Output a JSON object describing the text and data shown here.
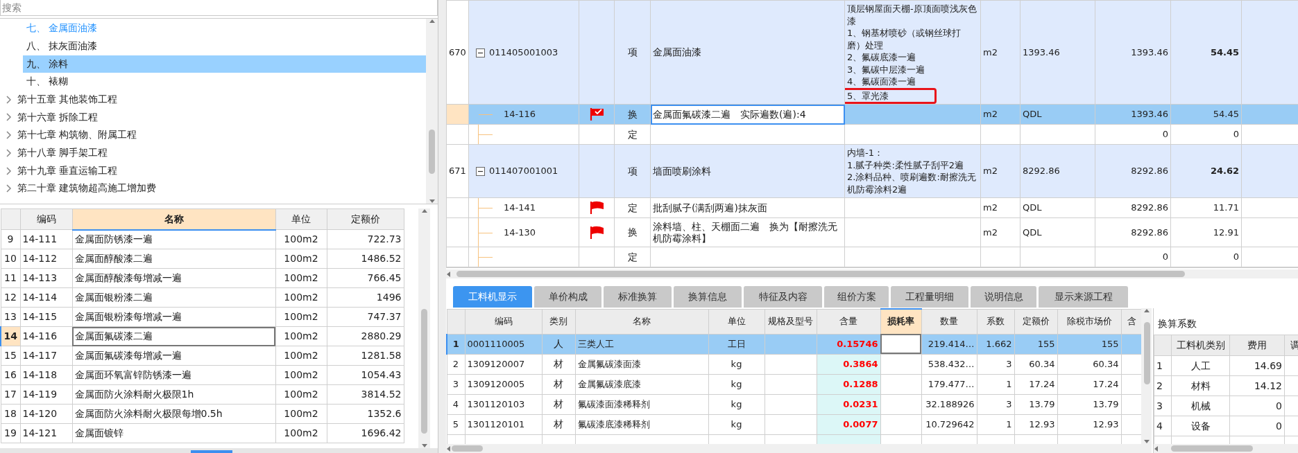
{
  "search": {
    "placeholder": "搜索"
  },
  "tree": {
    "items": [
      {
        "expanded": true,
        "children": [
          {
            "label": "七、 金属面油漆",
            "active": true,
            "selected": false
          },
          {
            "label": "八、 抹灰面油漆",
            "active": false,
            "selected": false
          },
          {
            "label": "九、 涂料",
            "active": false,
            "selected": true
          },
          {
            "label": "十、 裱糊",
            "active": false,
            "selected": false
          }
        ]
      },
      {
        "label": "第十五章 其他装饰工程",
        "expanded": false,
        "active": false,
        "selected": false
      },
      {
        "label": "第十六章 拆除工程",
        "expanded": false,
        "active": false,
        "selected": false
      },
      {
        "label": "第十七章 构筑物、附属工程",
        "expanded": false,
        "active": false,
        "selected": false
      },
      {
        "label": "第十八章 脚手架工程",
        "expanded": false,
        "active": false,
        "selected": false
      },
      {
        "label": "第十九章 垂直运输工程",
        "expanded": false,
        "active": false,
        "selected": false
      },
      {
        "label": "第二十章 建筑物超高施工增加费",
        "expanded": false,
        "active": false,
        "selected": false
      }
    ]
  },
  "quota_table": {
    "columns": [
      {
        "label": "编码",
        "active": false
      },
      {
        "label": "名称",
        "active": true
      },
      {
        "label": "单位",
        "active": false
      },
      {
        "label": "定额价",
        "active": false
      }
    ],
    "rows": [
      {
        "row_no": "9",
        "code": "14-111",
        "name": "金属面防锈漆一遍",
        "unit": "100m2",
        "price": "722.73",
        "selected": false
      },
      {
        "row_no": "10",
        "code": "14-112",
        "name": "金属面醇酸漆二遍",
        "unit": "100m2",
        "price": "1486.52",
        "selected": false
      },
      {
        "row_no": "11",
        "code": "14-113",
        "name": "金属面醇酸漆每增减一遍",
        "unit": "100m2",
        "price": "766.45",
        "selected": false
      },
      {
        "row_no": "12",
        "code": "14-114",
        "name": "金属面银粉漆二遍",
        "unit": "100m2",
        "price": "1496",
        "selected": false
      },
      {
        "row_no": "13",
        "code": "14-115",
        "name": "金属面银粉漆每增减一遍",
        "unit": "100m2",
        "price": "747.37",
        "selected": false
      },
      {
        "row_no": "14",
        "code": "14-116",
        "name": "金属面氟碳漆二遍",
        "unit": "100m2",
        "price": "2880.29",
        "selected": true
      },
      {
        "row_no": "15",
        "code": "14-117",
        "name": "金属面氟碳漆每增减一遍",
        "unit": "100m2",
        "price": "1281.58",
        "selected": false
      },
      {
        "row_no": "16",
        "code": "14-118",
        "name": "金属面环氧富锌防锈漆一遍",
        "unit": "100m2",
        "price": "1054.43",
        "selected": false
      },
      {
        "row_no": "17",
        "code": "14-119",
        "name": "金属面防火涂料耐火极限1h",
        "unit": "100m2",
        "price": "3814.52",
        "selected": false
      },
      {
        "row_no": "18",
        "code": "14-120",
        "name": "金属面防火涂料耐火极限每增0.5h",
        "unit": "100m2",
        "price": "1352.6",
        "selected": false
      },
      {
        "row_no": "19",
        "code": "14-121",
        "name": "金属面镀锌",
        "unit": "100m2",
        "price": "1696.42",
        "selected": false
      }
    ]
  },
  "bill_grid": {
    "rows": [
      {
        "kind": "item",
        "row_no": "670",
        "code": "011405001003",
        "expanded": true,
        "type": "项",
        "name": "金属面油漆",
        "description": [
          {
            "text": "顶层钢屋面天棚-原顶面喷浅灰色漆",
            "highlighted": false
          },
          {
            "text": "1、钢基材喷砂（或钢丝球打磨）处理",
            "highlighted": false
          },
          {
            "text": "2、氟碳底漆一遍",
            "highlighted": false
          },
          {
            "text": "3、氟碳中层漆一遍",
            "highlighted": false
          },
          {
            "text": "4、氟碳面漆一遍",
            "highlighted": false
          },
          {
            "text": "5、罩光漆",
            "highlighted": true
          }
        ],
        "unit": "m2",
        "qty_expr": "1393.46",
        "qty": "1393.46",
        "price": "54.45",
        "selected": false,
        "editing": false
      },
      {
        "kind": "quota",
        "code": "14-116",
        "flag": {
          "kind": "checked"
        },
        "type": "换",
        "name": "金属面氟碳漆二遍　实际遍数(遍):4",
        "unit": "m2",
        "qty_expr": "QDL",
        "qty": "1393.46",
        "price": "54.45",
        "selected": true,
        "editing": true
      },
      {
        "kind": "blank",
        "type": "定",
        "qty": "0",
        "price": "0",
        "selected": false,
        "editing": false
      },
      {
        "kind": "item",
        "row_no": "671",
        "code": "011407001001",
        "expanded": true,
        "type": "项",
        "name": "墙面喷刷涂料",
        "description": [
          {
            "text": "内墙-1：",
            "highlighted": false
          },
          {
            "text": "1.腻子种类:柔性腻子刮平2遍",
            "highlighted": false
          },
          {
            "text": "2.涂料品种、喷刷遍数:耐擦洗无机防霉涂料2遍",
            "highlighted": false
          }
        ],
        "unit": "m2",
        "qty_expr": "8292.86",
        "qty": "8292.86",
        "price": "24.62",
        "selected": false,
        "editing": false
      },
      {
        "kind": "quota",
        "code": "14-141",
        "flag": {
          "kind": "plain"
        },
        "type": "定",
        "name": "批刮腻子(满刮两遍)抹灰面",
        "unit": "m2",
        "qty_expr": "QDL",
        "qty": "8292.86",
        "price": "11.71",
        "selected": false,
        "editing": false
      },
      {
        "kind": "quota",
        "code": "14-130",
        "flag": {
          "kind": "plain"
        },
        "type": "换",
        "name": "涂料墙、柱、天棚面二遍　换为【耐擦洗无机防霉涂料】",
        "unit": "m2",
        "qty_expr": "QDL",
        "qty": "8292.86",
        "price": "12.91",
        "selected": false,
        "editing": false
      },
      {
        "kind": "blank",
        "type": "定",
        "qty": "0",
        "price": "0",
        "selected": false,
        "editing": false
      }
    ]
  },
  "tabs": [
    {
      "label": "工料机显示",
      "selected": true
    },
    {
      "label": "单价构成",
      "selected": false
    },
    {
      "label": "标准换算",
      "selected": false
    },
    {
      "label": "换算信息",
      "selected": false
    },
    {
      "label": "特征及内容",
      "selected": false
    },
    {
      "label": "组价方案",
      "selected": false
    },
    {
      "label": "工程量明细",
      "selected": false
    },
    {
      "label": "说明信息",
      "selected": false
    },
    {
      "label": "显示来源工程",
      "selected": false
    }
  ],
  "resource_grid": {
    "columns": [
      {
        "label": "编码",
        "active": false
      },
      {
        "label": "类别",
        "active": false
      },
      {
        "label": "名称",
        "active": false
      },
      {
        "label": "单位",
        "active": false
      },
      {
        "label": "规格及型号",
        "active": false
      },
      {
        "label": "含量",
        "active": false
      },
      {
        "label": "损耗率",
        "active": true
      },
      {
        "label": "数量",
        "active": false
      },
      {
        "label": "系数",
        "active": false
      },
      {
        "label": "定额价",
        "active": false
      },
      {
        "label": "除税市场价",
        "active": false
      },
      {
        "label": "含",
        "active": false
      }
    ],
    "rows": [
      {
        "row_no": "1",
        "code": "0001110005",
        "category": "人",
        "name": "三类人工",
        "unit": "工日",
        "content": "0.15746",
        "quantity": "219.414…",
        "coef": "1.662",
        "quota_price": "155",
        "market_price": "155",
        "selected": true
      },
      {
        "row_no": "2",
        "code": "1309120007",
        "category": "材",
        "name": "金属氟碳漆面漆",
        "unit": "kg",
        "content": "0.3864",
        "quantity": "538.432…",
        "coef": "3",
        "quota_price": "60.34",
        "market_price": "60.34",
        "selected": false
      },
      {
        "row_no": "3",
        "code": "1309120005",
        "category": "材",
        "name": "金属氟碳漆底漆",
        "unit": "kg",
        "content": "0.1288",
        "quantity": "179.477…",
        "coef": "1",
        "quota_price": "17.24",
        "market_price": "17.24",
        "selected": false
      },
      {
        "row_no": "4",
        "code": "1301120103",
        "category": "材",
        "name": "氟碳漆面漆稀释剂",
        "unit": "kg",
        "content": "0.0231",
        "quantity": "32.188926",
        "coef": "3",
        "quota_price": "13.79",
        "market_price": "13.79",
        "selected": false
      },
      {
        "row_no": "5",
        "code": "1301120101",
        "category": "材",
        "name": "氟碳漆底漆稀释剂",
        "unit": "kg",
        "content": "0.0077",
        "quantity": "10.729642",
        "coef": "1",
        "quota_price": "12.93",
        "market_price": "12.93",
        "selected": false
      }
    ]
  },
  "conversion_panel": {
    "title": "换算系数",
    "columns": [
      {
        "label": "工料机类别"
      },
      {
        "label": "费用"
      },
      {
        "label": "调"
      }
    ],
    "rows": [
      {
        "row_no": "1",
        "category": "人工",
        "amount": "14.69"
      },
      {
        "row_no": "2",
        "category": "材料",
        "amount": "14.12"
      },
      {
        "row_no": "3",
        "category": "机械",
        "amount": "0"
      },
      {
        "row_no": "4",
        "category": "设备",
        "amount": "0"
      }
    ]
  }
}
